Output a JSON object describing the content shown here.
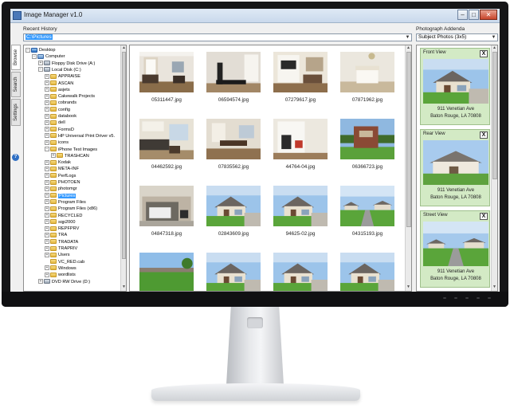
{
  "window": {
    "title": "Image Manager v1.0"
  },
  "recent_history": {
    "label": "Recent History",
    "value": "C:\\Pictures"
  },
  "addenda_header": {
    "label": "Photograph Addenda",
    "value": "Subject Photos (3x5)"
  },
  "side_tabs": [
    "Browse",
    "Search",
    "Settings"
  ],
  "tree": [
    {
      "label": "Desktop",
      "kind": "desk",
      "indent": 0,
      "exp": "−"
    },
    {
      "label": "Computer",
      "kind": "comp",
      "indent": 1,
      "exp": "−"
    },
    {
      "label": "Floppy Disk Drive (A:)",
      "kind": "drive",
      "indent": 2,
      "exp": "+"
    },
    {
      "label": "Local Disk (C:)",
      "kind": "drive",
      "indent": 2,
      "exp": "−"
    },
    {
      "label": "APPRAISE",
      "kind": "fld",
      "indent": 3,
      "exp": "+"
    },
    {
      "label": "ASCAN",
      "kind": "fld",
      "indent": 3,
      "exp": "+"
    },
    {
      "label": "asjets",
      "kind": "fld",
      "indent": 3,
      "exp": "+"
    },
    {
      "label": "Cakewalk Projects",
      "kind": "fld",
      "indent": 3,
      "exp": "+"
    },
    {
      "label": "cobrands",
      "kind": "fld",
      "indent": 3,
      "exp": "+"
    },
    {
      "label": "config",
      "kind": "fld",
      "indent": 3,
      "exp": "+"
    },
    {
      "label": "databook",
      "kind": "fld",
      "indent": 3,
      "exp": "+"
    },
    {
      "label": "dell",
      "kind": "fld",
      "indent": 3,
      "exp": "+"
    },
    {
      "label": "FormsD",
      "kind": "fld",
      "indent": 3,
      "exp": "+"
    },
    {
      "label": "HP Universal Print Driver v5.",
      "kind": "fld",
      "indent": 3,
      "exp": "+"
    },
    {
      "label": "icons",
      "kind": "fld",
      "indent": 3,
      "exp": "+"
    },
    {
      "label": "iPhone Test Images",
      "kind": "fld",
      "indent": 3,
      "exp": "−"
    },
    {
      "label": "TRASHCAN",
      "kind": "fld",
      "indent": 4,
      "exp": "+"
    },
    {
      "label": "Kodak",
      "kind": "fld",
      "indent": 3,
      "exp": "+"
    },
    {
      "label": "META-INF",
      "kind": "fld",
      "indent": 3,
      "exp": "+"
    },
    {
      "label": "PerfLogs",
      "kind": "fld",
      "indent": 3,
      "exp": "+"
    },
    {
      "label": "PHOTOEN",
      "kind": "fld",
      "indent": 3,
      "exp": "+"
    },
    {
      "label": "photomgr",
      "kind": "fld",
      "indent": 3,
      "exp": "+"
    },
    {
      "label": "Pictures",
      "kind": "fld",
      "indent": 3,
      "exp": "+",
      "selected": true
    },
    {
      "label": "Program Files",
      "kind": "fld",
      "indent": 3,
      "exp": "+"
    },
    {
      "label": "Program Files (x86)",
      "kind": "fld",
      "indent": 3,
      "exp": "+"
    },
    {
      "label": "RECYCLED",
      "kind": "fld",
      "indent": 3,
      "exp": "+"
    },
    {
      "label": "sqp2000",
      "kind": "fld",
      "indent": 3,
      "exp": "+"
    },
    {
      "label": "REPFPRV",
      "kind": "fld",
      "indent": 3,
      "exp": "+"
    },
    {
      "label": "TRA",
      "kind": "fld",
      "indent": 3,
      "exp": "+"
    },
    {
      "label": "TRADATA",
      "kind": "fld",
      "indent": 3,
      "exp": "+"
    },
    {
      "label": "TRAPRIV",
      "kind": "fld",
      "indent": 3,
      "exp": "+"
    },
    {
      "label": "Users",
      "kind": "fld",
      "indent": 3,
      "exp": "+"
    },
    {
      "label": "VC_RED.cab",
      "kind": "fld",
      "indent": 3,
      "exp": ""
    },
    {
      "label": "Windows",
      "kind": "fld",
      "indent": 3,
      "exp": "+"
    },
    {
      "label": "wordlists",
      "kind": "fld",
      "indent": 3,
      "exp": "+"
    },
    {
      "label": "DVD RW Drive (D:)",
      "kind": "drive",
      "indent": 2,
      "exp": "+"
    }
  ],
  "photos": [
    {
      "caption": "05311447.jpg",
      "scene": "interior-living"
    },
    {
      "caption": "06594574.jpg",
      "scene": "interior-treadmill"
    },
    {
      "caption": "07279617.jpg",
      "scene": "interior-tv"
    },
    {
      "caption": "07871962.jpg",
      "scene": "interior-bedroom"
    },
    {
      "caption": "04462592.jpg",
      "scene": "interior-kitchen"
    },
    {
      "caption": "07835562.jpg",
      "scene": "interior-dining"
    },
    {
      "caption": "44764-04.jpg",
      "scene": "interior-closet"
    },
    {
      "caption": "06366723.jpg",
      "scene": "exterior-sign"
    },
    {
      "caption": "04847318.jpg",
      "scene": "exterior-garage"
    },
    {
      "caption": "02843609.jpg",
      "scene": "exterior-house"
    },
    {
      "caption": "94625-02.jpg",
      "scene": "exterior-house"
    },
    {
      "caption": "04315193.jpg",
      "scene": "exterior-street"
    },
    {
      "caption": "",
      "scene": "exterior-lawn"
    },
    {
      "caption": "",
      "scene": "exterior-house"
    },
    {
      "caption": "",
      "scene": "exterior-house"
    },
    {
      "caption": "",
      "scene": "exterior-house"
    }
  ],
  "addenda": [
    {
      "title": "Front View",
      "close": "X",
      "line1": "911 Venetian Ave",
      "line2": "Baton Rouge, LA  70808",
      "scene": "exterior-house"
    },
    {
      "title": "Rear View",
      "close": "X",
      "line1": "911 Venetian Ave",
      "line2": "Baton Rouge, LA  70808",
      "scene": "exterior-rear"
    },
    {
      "title": "Street View",
      "close": "X",
      "line1": "911 Venetian Ave",
      "line2": "Baton Rouge, LA  70808",
      "scene": "exterior-street"
    }
  ]
}
